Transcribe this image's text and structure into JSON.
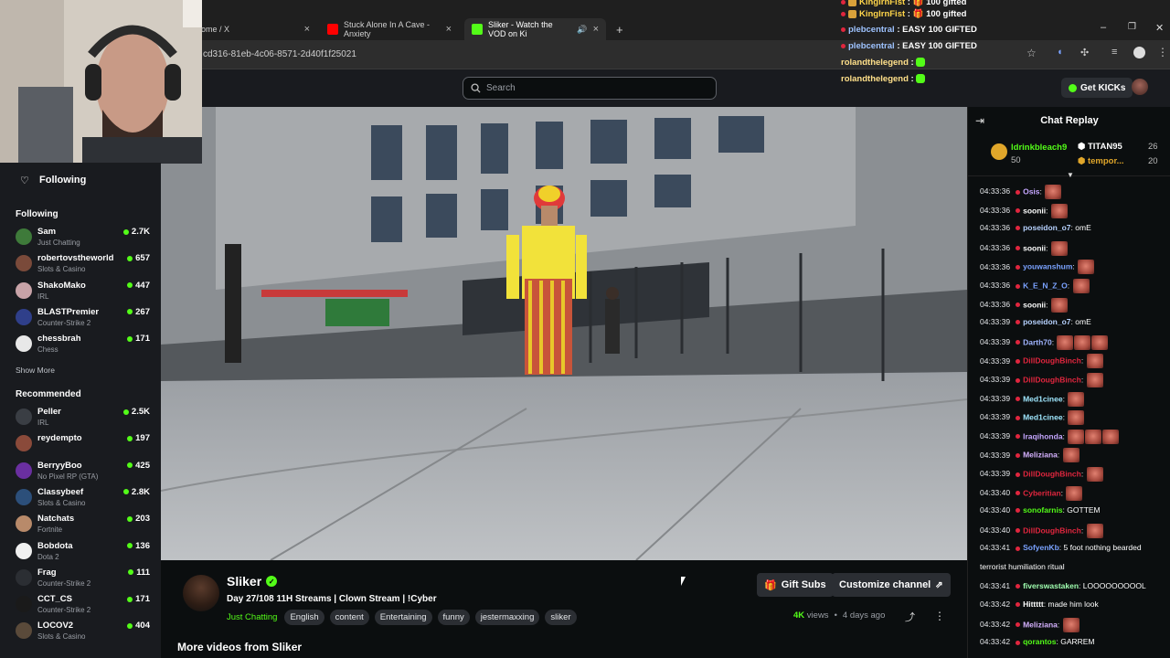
{
  "browser": {
    "tabs": [
      {
        "label": "ome / X",
        "close": "×"
      },
      {
        "label": "Stuck Alone In A Cave - Anxiety",
        "close": "×"
      },
      {
        "label": "Sliker - Watch the VOD on Ki",
        "close": "×"
      },
      {
        "label": "+",
        "close": ""
      }
    ],
    "url": "cd316-81eb-4c06-8571-2d40f1f25021",
    "controls": {
      "minimize": "–",
      "restore": "❐",
      "close": "✕"
    }
  },
  "kick": {
    "search_placeholder": "Search",
    "get_kicks": "Get KICKs"
  },
  "sidebar": {
    "header": "Following",
    "following_title": "Following",
    "following": [
      {
        "name": "Sam",
        "category": "Just Chatting",
        "viewers": "2.7K",
        "color": "#3e7a3a"
      },
      {
        "name": "robertovstheworld",
        "category": "Slots & Casino",
        "viewers": "657",
        "color": "#7a4a3a"
      },
      {
        "name": "ShakoMako",
        "category": "IRL",
        "viewers": "447",
        "color": "#c8a3a8"
      },
      {
        "name": "BLASTPremier",
        "category": "Counter-Strike 2",
        "viewers": "267",
        "color": "#2f3f8a"
      },
      {
        "name": "chessbrah",
        "category": "Chess",
        "viewers": "171",
        "color": "#e8e8e8"
      }
    ],
    "show_more": "Show More",
    "recommended_title": "Recommended",
    "recommended": [
      {
        "name": "Peller",
        "category": "IRL",
        "viewers": "2.5K",
        "color": "#3a3e44"
      },
      {
        "name": "reydempto",
        "category": "",
        "viewers": "197",
        "color": "#8a4a3a"
      },
      {
        "name": "BerryyBoo",
        "category": "No Pixel RP (GTA)",
        "viewers": "425",
        "color": "#6a2fa0"
      },
      {
        "name": "Classybeef",
        "category": "Slots & Casino",
        "viewers": "2.8K",
        "color": "#2c4f7a"
      },
      {
        "name": "Natchats",
        "category": "Fortnite",
        "viewers": "203",
        "color": "#b88a6a"
      },
      {
        "name": "Bobdota",
        "category": "Dota 2",
        "viewers": "136",
        "color": "#f0f0f0"
      },
      {
        "name": "Frag",
        "category": "Counter-Strike 2",
        "viewers": "111",
        "color": "#2b2e33"
      },
      {
        "name": "CCT_CS",
        "category": "Counter-Strike 2",
        "viewers": "171",
        "color": "#1a1a1a"
      },
      {
        "name": "LOCOV2",
        "category": "Slots & Casino",
        "viewers": "404",
        "color": "#5a4a3a"
      }
    ]
  },
  "stream": {
    "channel": "Sliker",
    "title": "Day 27/108 11H Streams | Clown Stream | !Cyber",
    "category": "Just Chatting",
    "tags": [
      "English",
      "content",
      "Entertaining",
      "funny",
      "jestermaxxing",
      "sliker"
    ],
    "gift_subs": "Gift Subs",
    "customize": "Customize channel",
    "views_number": "4K",
    "views_label": "views",
    "age": "4 days ago",
    "more_videos": "More videos from Sliker"
  },
  "chat": {
    "title": "Chat Replay",
    "leaderboard": [
      {
        "name": "ldrinkbleach9",
        "value": "50"
      },
      {
        "name": "TITAN95",
        "value": "26"
      },
      {
        "name": "tempor...",
        "value": "20"
      }
    ],
    "messages": [
      {
        "ts": "04:33:36",
        "user": "Osis",
        "color": "#c5a6ff",
        "text": "",
        "emotes": 1
      },
      {
        "ts": "04:33:36",
        "user": "soonii",
        "color": "#ffffff",
        "text": "",
        "emotes": 1
      },
      {
        "ts": "04:33:36",
        "user": "poseidon_o7",
        "color": "#b7d2ff",
        "text": "omE",
        "emotes": 0
      },
      {
        "ts": "04:33:36",
        "user": "soonii",
        "color": "#ffffff",
        "text": "",
        "emotes": 1
      },
      {
        "ts": "04:33:36",
        "user": "youwanshum",
        "color": "#7aa2ff",
        "text": "",
        "emotes": 1
      },
      {
        "ts": "04:33:36",
        "user": "K_E_N_Z_O",
        "color": "#7aa2ff",
        "text": "",
        "emotes": 1
      },
      {
        "ts": "04:33:36",
        "user": "soonii",
        "color": "#ffffff",
        "text": "",
        "emotes": 1
      },
      {
        "ts": "04:33:39",
        "user": "poseidon_o7",
        "color": "#b7d2ff",
        "text": "omE",
        "emotes": 0
      },
      {
        "ts": "04:33:39",
        "user": "Darth70",
        "color": "#a0b4ff",
        "text": "",
        "emotes": 3
      },
      {
        "ts": "04:33:39",
        "user": "DillDoughBinch",
        "color": "#e0263e",
        "text": "",
        "emotes": 1
      },
      {
        "ts": "04:33:39",
        "user": "DillDoughBinch",
        "color": "#e0263e",
        "text": "",
        "emotes": 1
      },
      {
        "ts": "04:33:39",
        "user": "Med1cinee",
        "color": "#a0e8ff",
        "text": "",
        "emotes": 1
      },
      {
        "ts": "04:33:39",
        "user": "Med1cinee",
        "color": "#a0e8ff",
        "text": "",
        "emotes": 1
      },
      {
        "ts": "04:33:39",
        "user": "Iraqihonda",
        "color": "#c5a6ff",
        "text": "",
        "emotes": 3
      },
      {
        "ts": "04:33:39",
        "user": "Meliziana",
        "color": "#d6b2ff",
        "text": "",
        "emotes": 1
      },
      {
        "ts": "04:33:39",
        "user": "DillDoughBinch",
        "color": "#e0263e",
        "text": "",
        "emotes": 1
      },
      {
        "ts": "04:33:40",
        "user": "Cyberitian",
        "color": "#e0263e",
        "text": "",
        "emotes": 1
      },
      {
        "ts": "04:33:40",
        "user": "sonofarnis",
        "color": "#53fc18",
        "text": "GOTTEM",
        "emotes": 0
      },
      {
        "ts": "04:33:40",
        "user": "DillDoughBinch",
        "color": "#e0263e",
        "text": "",
        "emotes": 1
      },
      {
        "ts": "04:33:41",
        "user": "SofyenKb",
        "color": "#7aa2ff",
        "text": "5 foot nothing bearded",
        "emotes": 0
      },
      {
        "ts": "",
        "user": "",
        "color": "#ffffff",
        "text": "terrorist humiliation ritual",
        "emotes": 0
      },
      {
        "ts": "04:33:41",
        "user": "fiverswastaken",
        "color": "#a0ffb0",
        "text": "LOOOOOOOOOL",
        "emotes": 0
      },
      {
        "ts": "04:33:42",
        "user": "Hittttt",
        "color": "#ffffff",
        "text": "made him look",
        "emotes": 0
      },
      {
        "ts": "04:33:42",
        "user": "Meliziana",
        "color": "#d6b2ff",
        "text": "",
        "emotes": 1
      },
      {
        "ts": "04:33:42",
        "user": "qorantos",
        "color": "#53fc18",
        "text": "GARREM",
        "emotes": 0
      }
    ]
  },
  "overlay": [
    {
      "user": "KingIrnFist",
      "color": "#ffd54a",
      "text": "100 gifted"
    },
    {
      "user": "KingIrnFist",
      "color": "#ffd54a",
      "text": "100 gifted"
    },
    {
      "user": "plebcentral",
      "color": "#9ec3ff",
      "text": "EASY 100 GIFTED"
    },
    {
      "user": "plebcentral",
      "color": "#9ec3ff",
      "text": "EASY 100 GIFTED"
    },
    {
      "user": "rolandthelegend",
      "color": "#ffe08a",
      "text": ""
    },
    {
      "user": "rolandthelegend",
      "color": "#ffe08a",
      "text": ""
    }
  ],
  "colors": {
    "accent": "#53fc18",
    "bg": "#0b0e0f",
    "panel": "#191b1f"
  }
}
